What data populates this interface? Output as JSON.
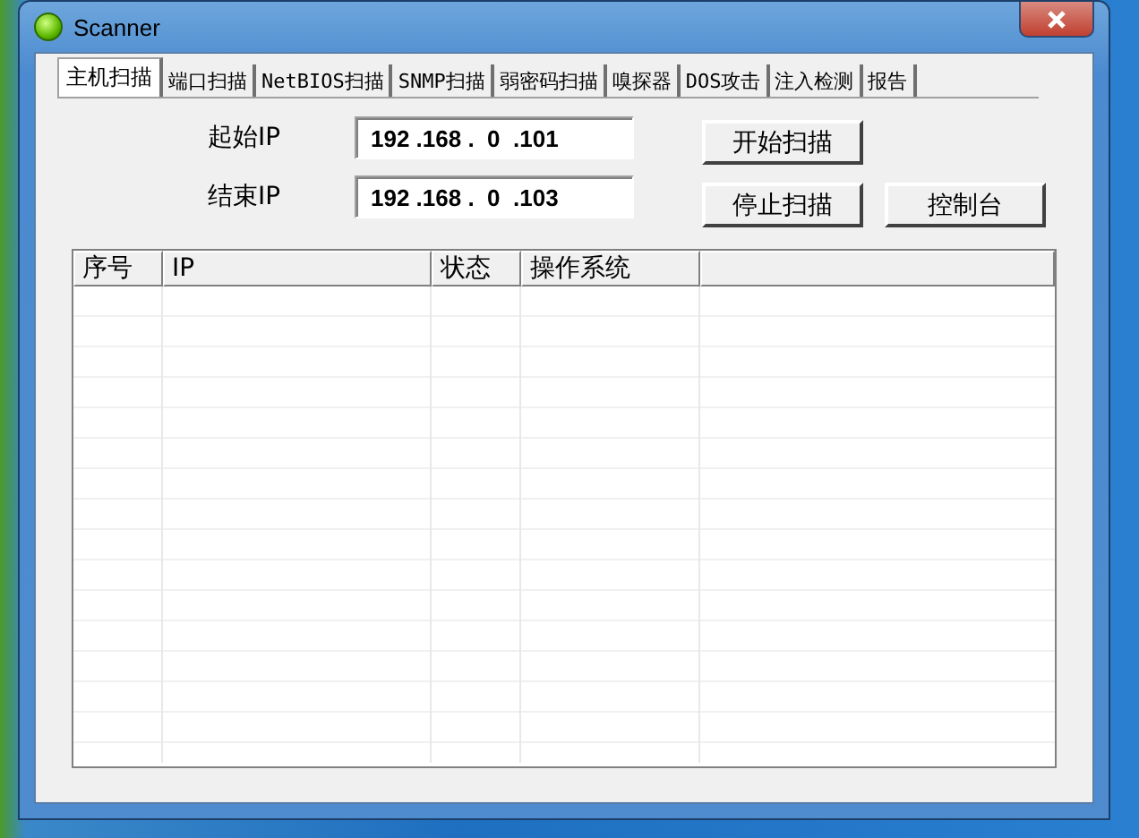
{
  "window": {
    "title": "Scanner"
  },
  "tabs": [
    {
      "label": "主机扫描",
      "selected": true
    },
    {
      "label": "端口扫描",
      "selected": false
    },
    {
      "label": "NetBIOS扫描",
      "selected": false
    },
    {
      "label": "SNMP扫描",
      "selected": false
    },
    {
      "label": "弱密码扫描",
      "selected": false
    },
    {
      "label": "嗅探器",
      "selected": false
    },
    {
      "label": "DOS攻击",
      "selected": false
    },
    {
      "label": "注入检测",
      "selected": false
    },
    {
      "label": "报告",
      "selected": false
    }
  ],
  "start_ip": {
    "label": "起始IP",
    "value": "192 .168 .  0  .101"
  },
  "end_ip": {
    "label": "结束IP",
    "value": "192 .168 .  0  .103"
  },
  "buttons": {
    "start": "开始扫描",
    "stop": "停止扫描",
    "console": "控制台"
  },
  "table": {
    "columns": [
      "序号",
      "IP",
      "状态",
      "操作系统"
    ]
  }
}
